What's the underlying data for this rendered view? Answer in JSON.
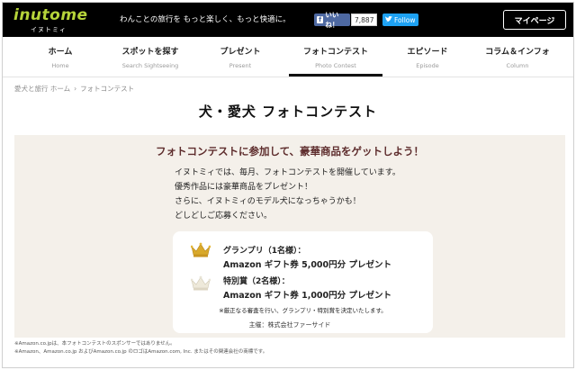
{
  "header": {
    "logo_text": "inutome",
    "logo_sub": "イヌトミィ",
    "tagline": "わんことの旅行を もっと楽しく、もっと快適に。",
    "like_label": "いいね！",
    "like_count": "7,887",
    "follow_label": "Follow",
    "mypage_label": "マイページ"
  },
  "nav": [
    {
      "jp": "ホーム",
      "en": "Home"
    },
    {
      "jp": "スポットを探す",
      "en": "Search Sightseeing"
    },
    {
      "jp": "プレゼント",
      "en": "Present"
    },
    {
      "jp": "フォトコンテスト",
      "en": "Photo Contest"
    },
    {
      "jp": "エピソード",
      "en": "Episode"
    },
    {
      "jp": "コラム＆インフォ",
      "en": "Column"
    }
  ],
  "breadcrumb": {
    "home": "愛犬と旅行 ホーム",
    "separator": "›",
    "current": "フォトコンテスト"
  },
  "page_title": "犬・愛犬 フォトコンテスト",
  "contest": {
    "heading": "フォトコンテストに参加して、豪華商品をゲットしよう！",
    "desc": [
      "イヌトミィでは、毎月、フォトコンテストを開催しています。",
      "優秀作品には豪華商品をプレゼント！",
      "さらに、イヌトミィのモデル犬になっちゃうかも！",
      "どしどしご応募ください。"
    ],
    "prizes": [
      {
        "title": "グランプリ（1名様）：",
        "desc": "Amazon ギフト券 5,000円分 プレゼント",
        "crown_color": "#d9a92a"
      },
      {
        "title": "特別賞（2名様）：",
        "desc": "Amazon ギフト券 1,000円分 プレゼント",
        "crown_color": "#e8e4d6"
      }
    ],
    "prize_note": "※厳正なる審査を行い、グランプリ・特別賞を決定いたします。",
    "sponsor": "主催：株式会社ファーサイド"
  },
  "footnotes": [
    "※Amazon.co.jpは、本フォトコンテストのスポンサーではありません。",
    "※Amazon、Amazon.co.jp およびAmazon.co.jp のロゴはAmazon.com, Inc. またはその関連会社の商標です。"
  ]
}
